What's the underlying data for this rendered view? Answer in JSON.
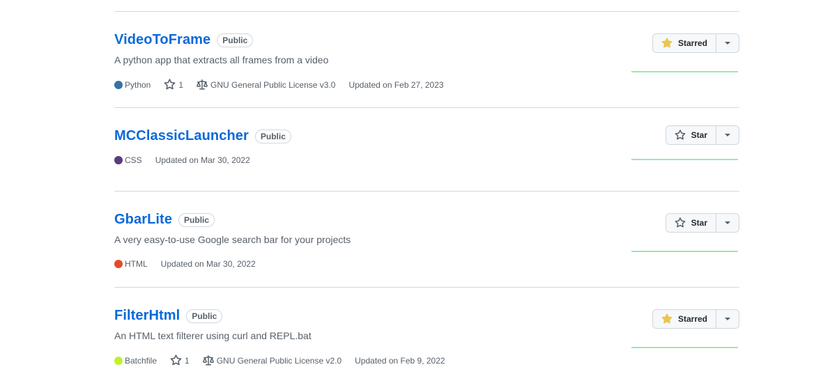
{
  "colors": {
    "link": "#0969da",
    "muted": "#57606a",
    "star_filled": "#eac54f",
    "activity_line": "#9be9a8"
  },
  "repos": [
    {
      "name": "VideoToFrame",
      "visibility": "Public",
      "description": "A python app that extracts all frames from a video",
      "language": "Python",
      "language_color": "#3572A5",
      "stars": "1",
      "license": "GNU General Public License v3.0",
      "updated": "Updated on Feb 27, 2023",
      "star_label": "Starred",
      "starred": true
    },
    {
      "name": "MCClassicLauncher",
      "visibility": "Public",
      "description": "",
      "language": "CSS",
      "language_color": "#563d7c",
      "stars": "",
      "license": "",
      "updated": "Updated on Mar 30, 2022",
      "star_label": "Star",
      "starred": false
    },
    {
      "name": "GbarLite",
      "visibility": "Public",
      "description": "A very easy-to-use Google search bar for your projects",
      "language": "HTML",
      "language_color": "#e34c26",
      "stars": "",
      "license": "",
      "updated": "Updated on Mar 30, 2022",
      "star_label": "Star",
      "starred": false
    },
    {
      "name": "FilterHtml",
      "visibility": "Public",
      "description": "An HTML text filterer using curl and REPL.bat",
      "language": "Batchfile",
      "language_color": "#C1F12E",
      "stars": "1",
      "license": "GNU General Public License v2.0",
      "updated": "Updated on Feb 9, 2022",
      "star_label": "Starred",
      "starred": true
    }
  ]
}
